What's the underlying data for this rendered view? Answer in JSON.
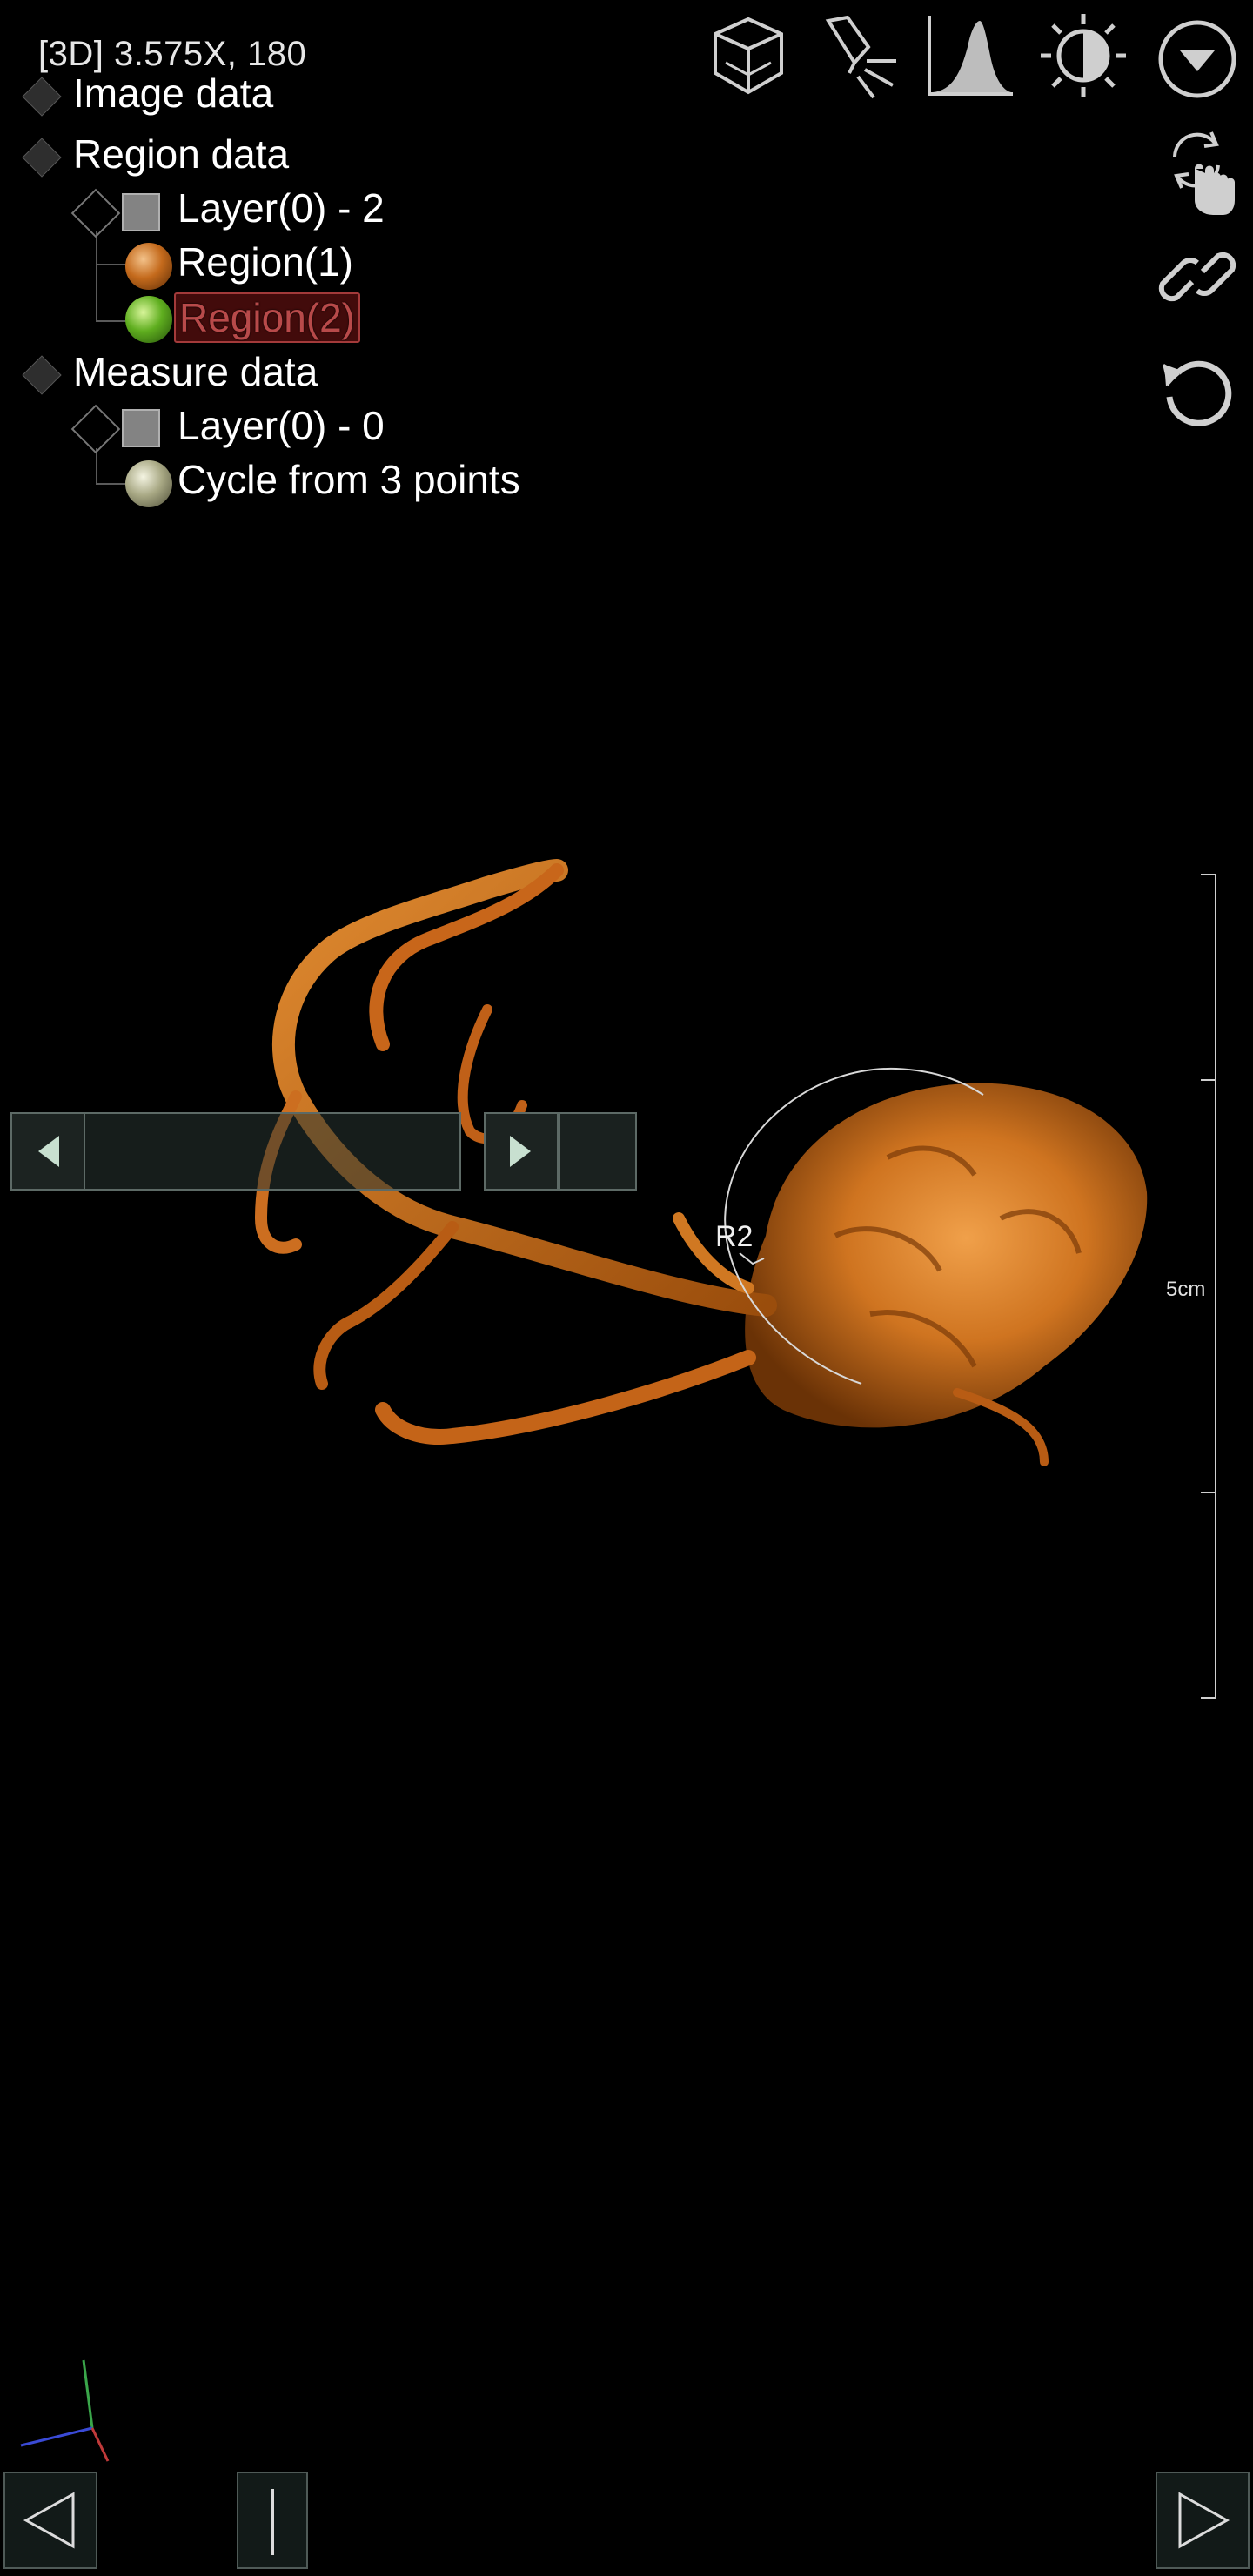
{
  "status": {
    "view_info": "[3D] 3.575X, 180"
  },
  "tree": {
    "image_data": "Image data",
    "region_data": "Region data",
    "region_layer": "Layer(0) - 2",
    "region1": "Region(1)",
    "region2": "Region(2)",
    "measure_data": "Measure data",
    "measure_layer": "Layer(0) - 0",
    "measure_item": "Cycle from 3 points"
  },
  "toolbar": {
    "icons": [
      "cube-view-icon",
      "light-icon",
      "histogram-icon",
      "contrast-icon",
      "dropdown-icon",
      "rotate-touch-icon",
      "link-icon",
      "reset-icon"
    ]
  },
  "measurement": {
    "label": "R2"
  },
  "scale": {
    "label": "5cm"
  },
  "colors": {
    "volume": "#d47a1c",
    "region2_highlight": "#a33a3a",
    "button_border": "#5d6a66"
  }
}
